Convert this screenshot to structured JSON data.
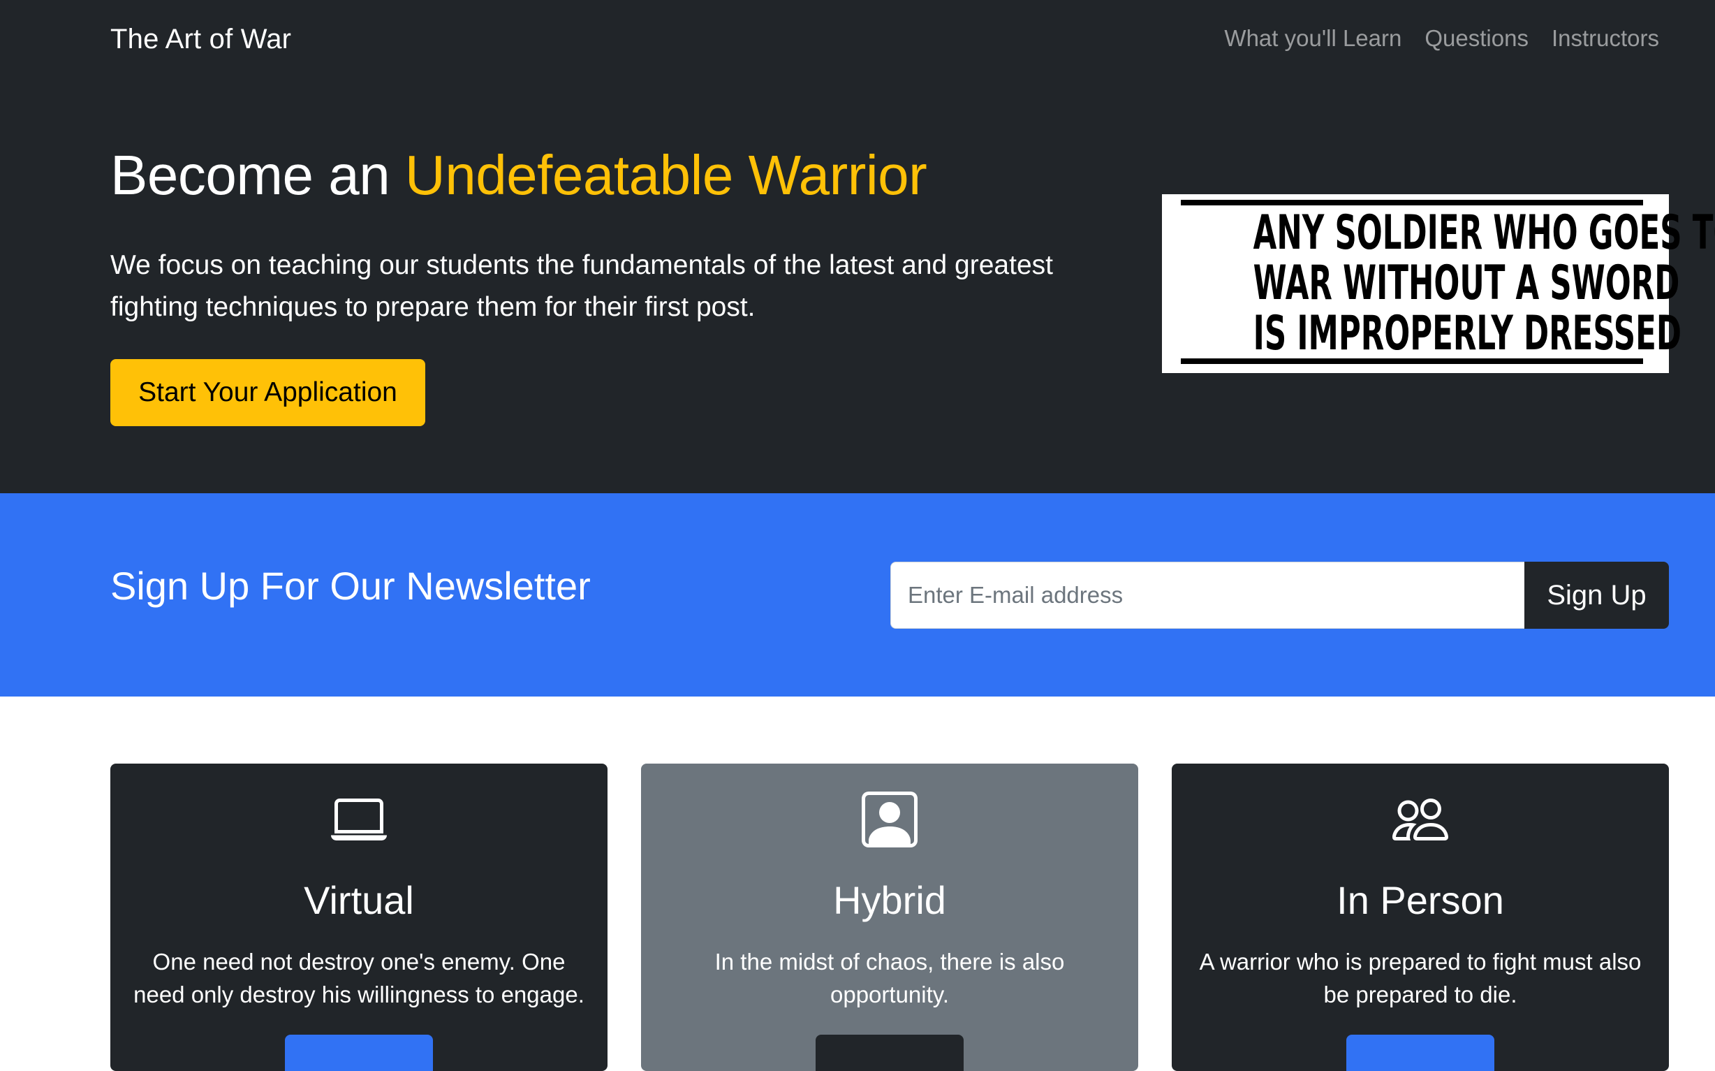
{
  "navbar": {
    "brand": "The Art of War",
    "links": [
      "What you'll Learn",
      "Questions",
      "Instructors"
    ]
  },
  "hero": {
    "title_prefix": "Become an ",
    "title_accent": "Undefeatable Warrior",
    "lead": "We focus on teaching our students the fundamentals of the latest and greatest fighting techniques to prepare them for their first post.",
    "cta_label": "Start Your Application",
    "quote_image": {
      "lines": [
        "ANY SOLDIER WHO GOES TO",
        "WAR WITHOUT A SWORD",
        "IS IMPROPERLY DRESSED"
      ]
    }
  },
  "newsletter": {
    "title": "Sign Up For Our Newsletter",
    "email_placeholder": "Enter E-mail address",
    "button_label": "Sign Up"
  },
  "cards": [
    {
      "icon": "laptop-icon",
      "title": "Virtual",
      "text": "One need not destroy one's enemy. One need only destroy his willingness to engage."
    },
    {
      "icon": "person-square-icon",
      "title": "Hybrid",
      "text": "In the midst of chaos, there is also opportunity."
    },
    {
      "icon": "people-icon",
      "title": "In Person",
      "text": "A warrior who is prepared to fight must also be prepared to die."
    }
  ],
  "colors": {
    "dark": "#212529",
    "accent_yellow": "#ffc107",
    "primary_blue": "#3172f4",
    "secondary_gray": "#6c757d"
  }
}
